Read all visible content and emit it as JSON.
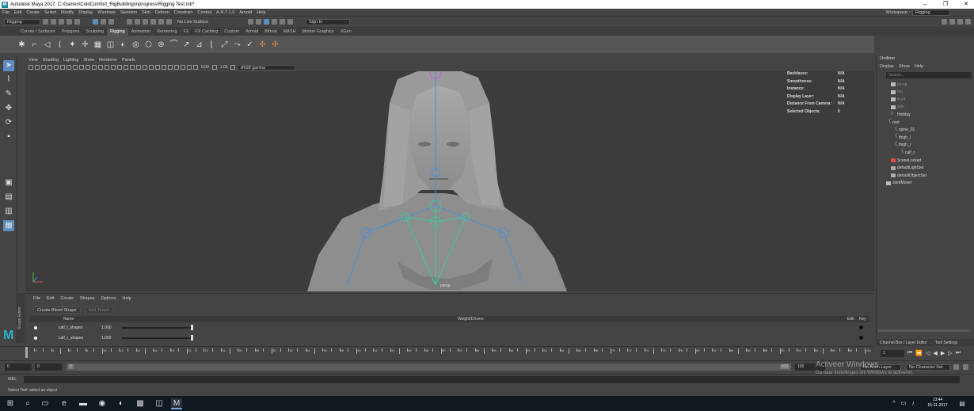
{
  "window": {
    "title": "Autodesk Maya 2017: C:\\Games\\ColdComfort_RigBuilding\\inprogress\\Rigging Test.mb*",
    "logo": "M"
  },
  "menubar": {
    "items": [
      "File",
      "Edit",
      "Create",
      "Select",
      "Modify",
      "Display",
      "Windows",
      "Skeleton",
      "Skin",
      "Deform",
      "Constrain",
      "Control",
      "A.R.T 1.0",
      "Arnold",
      "Help"
    ],
    "workspace_label": "Workspace :",
    "workspace_value": "Rigging"
  },
  "statusline": {
    "menuset": "Rigging",
    "live_surface": "No Live Surface",
    "sign_in": "Sign In"
  },
  "shelf": {
    "tabs": [
      "Curves / Surfaces",
      "Polygons",
      "Sculpting",
      "Rigging",
      "Animation",
      "Rendering",
      "FX",
      "FX Caching",
      "Custom",
      "Arnold",
      "Bifrost",
      "MASH",
      "Motion Graphics",
      "XGen"
    ],
    "active_tab": "Rigging"
  },
  "panel": {
    "menus": [
      "View",
      "Shading",
      "Lighting",
      "Show",
      "Renderer",
      "Panels"
    ],
    "field_a": "0.00",
    "field_b": "1.00",
    "colorspace": "sRGB gamma"
  },
  "hud": [
    {
      "label": "Backfaces:",
      "value": "N/A"
    },
    {
      "label": "Smoothness:",
      "value": "N/A"
    },
    {
      "label": "Instance:",
      "value": "N/A"
    },
    {
      "label": "Display Layer:",
      "value": "N/A"
    },
    {
      "label": "Distance From Camera:",
      "value": "N/A"
    },
    {
      "label": "Selected Objects:",
      "value": "0"
    }
  ],
  "viewport": {
    "camera": "persp"
  },
  "shape_editor": {
    "panel_label": "Shape Editor",
    "menus": [
      "File",
      "Edit",
      "Create",
      "Shapes",
      "Options",
      "Help"
    ],
    "create_button": "Create Blend Shape",
    "add_target": "Add Target",
    "col_name": "Name",
    "col_weight": "Weight/Drivers",
    "col_edit": "Edit",
    "col_key": "Key",
    "rows": [
      {
        "name": "calf_l_shapes",
        "weight": "1.000"
      },
      {
        "name": "calf_r_shapes",
        "weight": "1.000"
      }
    ]
  },
  "outliner": {
    "title": "Outliner",
    "menus": [
      "Display",
      "Show",
      "Help"
    ],
    "search_placeholder": "Search...",
    "items": [
      {
        "label": "persp",
        "icon": "camera",
        "dim": true
      },
      {
        "label": "top",
        "icon": "camera",
        "dim": true
      },
      {
        "label": "front",
        "icon": "camera",
        "dim": true
      },
      {
        "label": "side",
        "icon": "camera",
        "dim": true
      },
      {
        "label": "Holiday",
        "icon": "nurbs-curve",
        "dim": false
      },
      {
        "label": "root",
        "icon": "joint",
        "dim": false
      },
      {
        "label": "spine_01",
        "icon": "joint",
        "dim": false
      },
      {
        "label": "thigh_l",
        "icon": "joint",
        "dim": false
      },
      {
        "label": "thigh_r",
        "icon": "joint",
        "dim": false
      },
      {
        "label": "calf_r",
        "icon": "joint",
        "dim": false
      },
      {
        "label": "SceneLocked",
        "icon": "script",
        "dim": false
      },
      {
        "label": "defaultLightSet",
        "icon": "set",
        "dim": false
      },
      {
        "label": "defaultObjectSet",
        "icon": "set",
        "dim": false
      },
      {
        "label": "JointMover",
        "icon": "group",
        "dim": false
      }
    ]
  },
  "channel_tabs": [
    "Channel Box / Layer Editor",
    "Tool Settings"
  ],
  "timeline": {
    "current_frame": "1",
    "range_start": "0",
    "range_start_inner": "0",
    "range_slider_start": "0",
    "range_slider_end": "100",
    "range_end": "100",
    "anim_layer": "No Anim Layer",
    "character_set": "No Character Set",
    "max_frame": 100
  },
  "commandline": {
    "label": "MEL",
    "help": "Select Tool: select an object"
  },
  "watermark": {
    "line1": "Activeer Windows",
    "line2": "Ga naar Instellingen om Windows te activeren."
  },
  "taskbar": {
    "time": "13:44",
    "date": "15-11-2017"
  },
  "colors": {
    "accent": "#5c8bbf",
    "maya_teal": "#2bb3c2",
    "shelf_orange": "#e98a3c"
  }
}
